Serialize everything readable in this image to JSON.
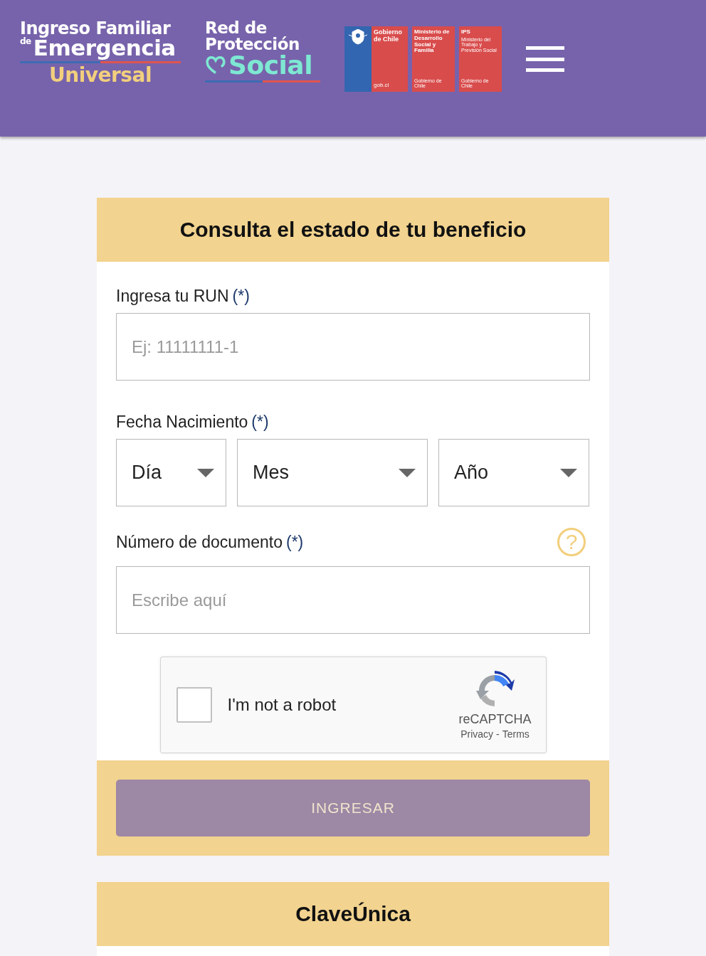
{
  "header": {
    "logo_ife": {
      "line_1": "Ingreso Familiar",
      "prefix": "de",
      "line_2": "Emergencia",
      "line_3": "Universal"
    },
    "logo_red": {
      "line_1": "Red de",
      "line_2": "Protección",
      "line_3": "Social"
    },
    "gov_logos": [
      {
        "kind": "gobierno",
        "title": "Gobierno de Chile",
        "footer": "gob.cl"
      },
      {
        "kind": "ministry",
        "title": "Ministerio de Desarrollo Social y Familia",
        "footer": "Gobierno de Chile"
      },
      {
        "kind": "ministry",
        "title": "IPS",
        "subtitle": "Ministerio del Trabajo y Previsión Social",
        "footer": "Gobierno de Chile"
      }
    ]
  },
  "form": {
    "title": "Consulta el estado de tu beneficio",
    "run": {
      "label": "Ingresa tu RUN",
      "required": "(*)",
      "placeholder": "Ej: 11111111-1"
    },
    "birth": {
      "label": "Fecha Nacimiento",
      "required": "(*)",
      "selects": [
        "Día",
        "Mes",
        "Año"
      ]
    },
    "document": {
      "label": "Número de documento",
      "required": "(*)",
      "help": "?",
      "placeholder": "Escribe aquí"
    },
    "captcha": {
      "checked": false,
      "label": "I'm not a robot",
      "brand": "reCAPTCHA",
      "privacy": "Privacy",
      "separator": "-",
      "terms": "Terms"
    },
    "submit": {
      "label": "INGRESAR",
      "disabled": true
    }
  },
  "second_card": {
    "title": "ClaveÚnica"
  }
}
